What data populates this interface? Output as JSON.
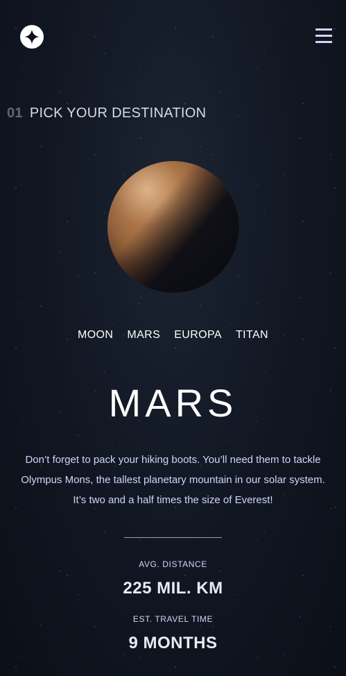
{
  "header": {
    "logo_icon": "star-compass-icon",
    "menu_icon": "hamburger-menu-icon"
  },
  "section": {
    "number": "01",
    "title": "PICK YOUR DESTINATION"
  },
  "tabs": [
    {
      "label": "MOON"
    },
    {
      "label": "MARS",
      "selected": true
    },
    {
      "label": "EUROPA"
    },
    {
      "label": "TITAN"
    }
  ],
  "destination": {
    "name": "MARS",
    "description": "Don’t forget to pack your hiking boots. You’ll need them to tackle Olympus Mons, the tallest planetary mountain in our solar system. It’s two and a half times the size of Everest!",
    "distance_label": "AVG. DISTANCE",
    "distance_value": "225 MIL. KM",
    "travel_label": "EST. TRAVEL TIME",
    "travel_value": "9 MONTHS"
  },
  "colors": {
    "background": "#121824",
    "accent": "#d0d6f9",
    "text": "#ffffff"
  }
}
